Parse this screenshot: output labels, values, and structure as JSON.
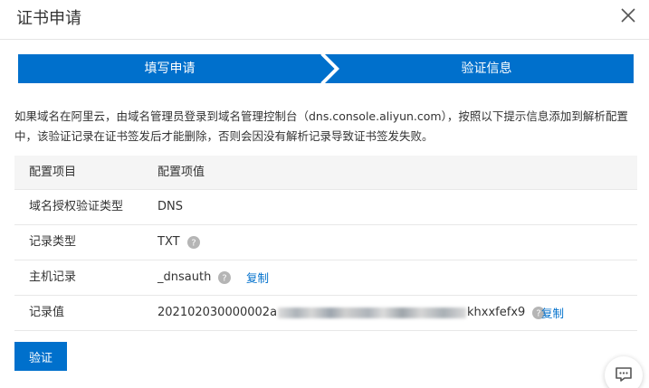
{
  "dialog": {
    "title": "证书申请"
  },
  "steps": [
    {
      "label": "填写申请"
    },
    {
      "label": "验证信息"
    }
  ],
  "description": "如果域名在阿里云，由域名管理员登录到域名管理控制台（dns.console.aliyun.com），按照以下提示信息添加到解析配置中，该验证记录在证书签发后才能删除，否则会因没有解析记录导致证书签发失败。",
  "table": {
    "header": {
      "key": "配置项目",
      "value": "配置项值"
    },
    "rows": [
      {
        "key": "域名授权验证类型",
        "value": "DNS"
      },
      {
        "key": "记录类型",
        "value": "TXT"
      },
      {
        "key": "主机记录",
        "value": "_dnsauth",
        "copy": "复制"
      },
      {
        "key": "记录值",
        "value_prefix": "202102030000002a",
        "value_suffix": "khxxfefx9",
        "copy": "复制"
      }
    ]
  },
  "buttons": {
    "verify": "验证"
  },
  "colors": {
    "primary": "#0070cc",
    "step_bg": "#0070cc"
  },
  "icons": {
    "close": "close-icon",
    "help": "question-circle-icon",
    "chat": "chat-icon"
  }
}
